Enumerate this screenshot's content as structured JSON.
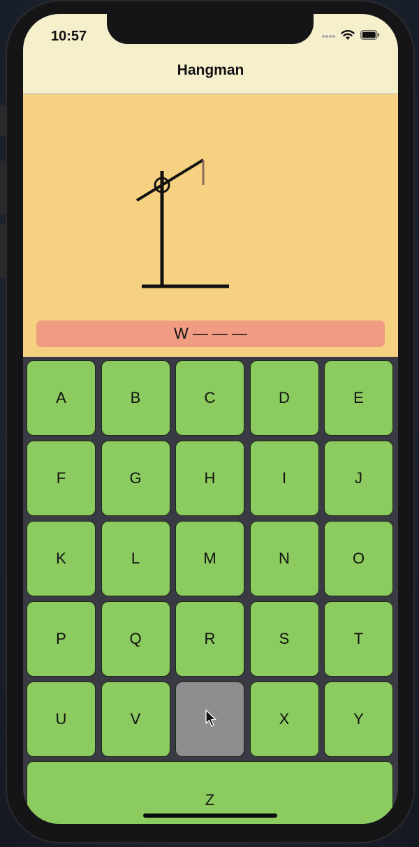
{
  "status": {
    "time": "10:57"
  },
  "nav": {
    "title": "Hangman"
  },
  "game": {
    "word_display": "W — — —",
    "row1": [
      "A",
      "B",
      "C",
      "D",
      "E"
    ],
    "row2": [
      "F",
      "G",
      "H",
      "I",
      "J"
    ],
    "row3": [
      "K",
      "L",
      "M",
      "N",
      "O"
    ],
    "row4": [
      "P",
      "Q",
      "R",
      "S",
      "T"
    ],
    "row5": [
      "U",
      "V",
      "",
      "X",
      "Y"
    ],
    "last_key": "Z",
    "used_letter": "W"
  },
  "colors": {
    "nav_bg": "#f5efcc",
    "gallows_bg": "#f5d181",
    "word_bg": "#f09c82",
    "key_bg": "#8bcb5f",
    "used_key_bg": "#8e8d90",
    "keyboard_bg": "#3a3a44"
  },
  "icons": {
    "signal": "cellular-signal-icon",
    "wifi": "wifi-icon",
    "battery": "battery-icon",
    "cursor": "mouse-pointer-icon"
  }
}
